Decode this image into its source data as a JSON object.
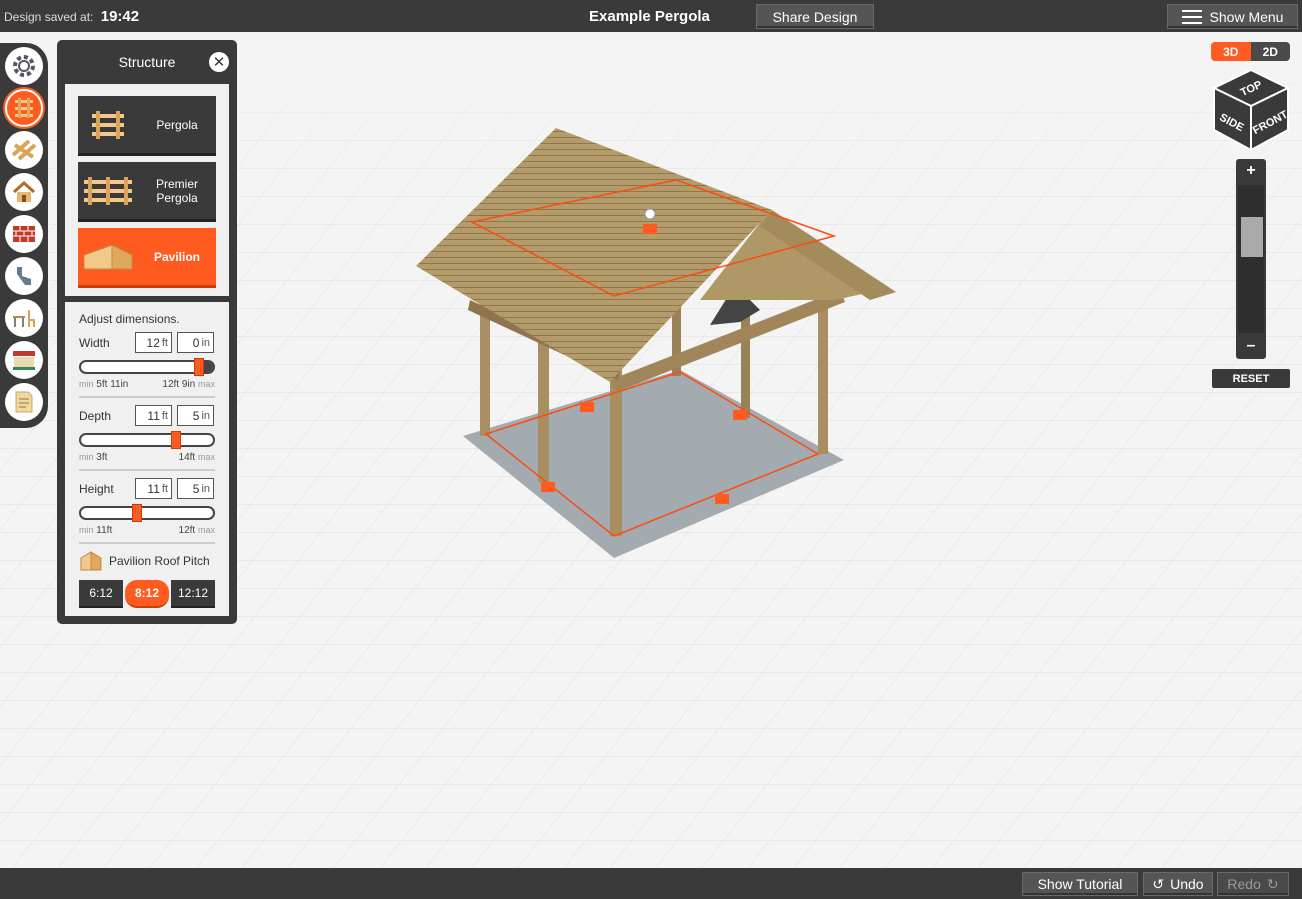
{
  "topbar": {
    "saved_label": "Design saved at:",
    "saved_time": "19:42",
    "title": "Example Pergola",
    "share_label": "Share Design",
    "menu_label": "Show Menu"
  },
  "bottombar": {
    "tutorial_label": "Show Tutorial",
    "undo_label": "Undo",
    "redo_label": "Redo"
  },
  "rail": {
    "items": [
      {
        "icon": "gear-icon"
      },
      {
        "icon": "structure-icon",
        "active": true
      },
      {
        "icon": "lumber-icon"
      },
      {
        "icon": "house-icon"
      },
      {
        "icon": "brick-wall-icon"
      },
      {
        "icon": "bracket-icon"
      },
      {
        "icon": "furniture-icon"
      },
      {
        "icon": "store-icon"
      },
      {
        "icon": "document-icon"
      }
    ]
  },
  "panel": {
    "title": "Structure",
    "options": [
      {
        "label": "Pergola",
        "active": false
      },
      {
        "label": "Premier Pergola",
        "active": false
      },
      {
        "label": "Pavilion",
        "active": true
      }
    ],
    "adjust_label": "Adjust dimensions.",
    "width": {
      "label": "Width",
      "ft": "12",
      "in": "0",
      "min_label": "min",
      "min": "5ft 11in",
      "max": "12ft 9in",
      "max_label": "max",
      "value_fraction": 0.93
    },
    "depth": {
      "label": "Depth",
      "ft": "11",
      "in": "5",
      "min_label": "min",
      "min": "3ft",
      "max": "14ft",
      "max_label": "max",
      "value_fraction": 0.74
    },
    "height": {
      "label": "Height",
      "ft": "11",
      "in": "5",
      "min_label": "min",
      "min": "11ft",
      "max": "12ft",
      "max_label": "max",
      "value_fraction": 0.42
    },
    "ft_unit": "ft",
    "in_unit": "in",
    "pitch_label": "Pavilion Roof Pitch",
    "pitch_options": [
      "6:12",
      "8:12",
      "12:12"
    ],
    "pitch_selected": "8:12"
  },
  "view": {
    "mode_3d": "3D",
    "mode_2d": "2D",
    "active_mode": "3D",
    "cube_top": "TOP",
    "cube_side": "SIDE",
    "cube_front": "FRONT",
    "zoom_in": "+",
    "zoom_out": "–",
    "zoom_level": 0.7,
    "reset_label": "RESET"
  },
  "colors": {
    "accent": "#ff5a1f",
    "dark": "#3a3a3a",
    "wood": "#b39a6a"
  }
}
